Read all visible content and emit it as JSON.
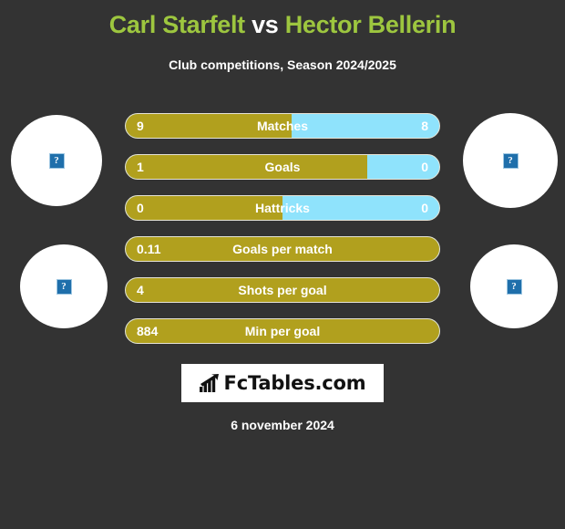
{
  "header": {
    "title_home": "Carl Starfelt",
    "title_vs": "vs",
    "title_away": "Hector Bellerin",
    "subtitle": "Club competitions, Season 2024/2025"
  },
  "colors": {
    "background": "#333333",
    "title_green": "#9dc63f",
    "home_gold": "#b1a01e",
    "away_blue": "#8fe3fc",
    "text_white": "#ffffff",
    "placeholder_blue": "#1f6fab"
  },
  "players": {
    "home": {
      "name": "Carl Starfelt",
      "photo_top_alt": "?",
      "photo_bottom_alt": "?"
    },
    "away": {
      "name": "Hector Bellerin",
      "photo_top_alt": "?",
      "photo_bottom_alt": "?"
    }
  },
  "chart_data": {
    "type": "bar",
    "title": "Carl Starfelt vs Hector Bellerin",
    "subtitle": "Club competitions, Season 2024/2025",
    "orientation": "horizontal-diverging",
    "series": [
      {
        "name": "Carl Starfelt",
        "color": "#b1a01e"
      },
      {
        "name": "Hector Bellerin",
        "color": "#8fe3fc"
      }
    ],
    "categories": [
      "Matches",
      "Goals",
      "Hattricks",
      "Goals per match",
      "Shots per goal",
      "Min per goal"
    ],
    "rows": [
      {
        "label": "Matches",
        "home": "9",
        "away": "8",
        "home_pct": 53
      },
      {
        "label": "Goals",
        "home": "1",
        "away": "0",
        "home_pct": 77
      },
      {
        "label": "Hattricks",
        "home": "0",
        "away": "0",
        "home_pct": 50
      },
      {
        "label": "Goals per match",
        "home": "0.11",
        "away": "",
        "home_pct": 100
      },
      {
        "label": "Shots per goal",
        "home": "4",
        "away": "",
        "home_pct": 100
      },
      {
        "label": "Min per goal",
        "home": "884",
        "away": "",
        "home_pct": 100
      }
    ]
  },
  "logo": {
    "text": "FcTables.com",
    "icon": "bar-chart-icon"
  },
  "footer": {
    "date": "6 november 2024"
  }
}
